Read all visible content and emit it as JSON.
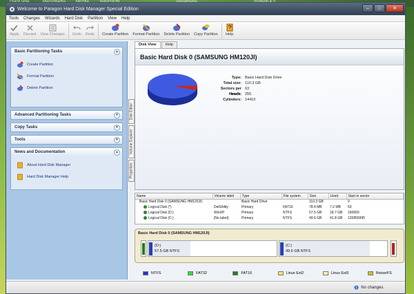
{
  "desktop": {
    "taskbar_items": [
      "QuickTime",
      "Macromedia",
      "Mozilla",
      "NAVISION",
      "vatvaktama",
      "msftedit 4.0"
    ]
  },
  "window": {
    "title": "Welcome to Paragon Hard Disk Manager Special Edition"
  },
  "menu": [
    "Tools",
    "Changes",
    "Wizards",
    "Hard Disk",
    "Partition",
    "View",
    "Help"
  ],
  "toolbar": {
    "apply": "Apply",
    "discard": "Discard",
    "view_changes": "View Changes",
    "undo": "Undo",
    "redo": "Redo",
    "create_partition": "Create Partition",
    "format_partition": "Format Partition",
    "delete_partition": "Delete Partition",
    "copy_partition": "Copy Partition",
    "help": "Help"
  },
  "sidebar": {
    "basic": {
      "title": "Basic Partitioning Tasks",
      "items": [
        "Create Partition",
        "Format Partition",
        "Delete Partition"
      ]
    },
    "advanced": {
      "title": "Advanced Partitioning Tasks"
    },
    "copy": {
      "title": "Copy Tasks"
    },
    "tools": {
      "title": "Tools"
    },
    "news": {
      "title": "News and Documentation",
      "items": [
        "About Hard Disk Manager",
        "Hard Disk Manager Help"
      ]
    }
  },
  "vtabs": [
    "Disk Editor",
    "Volume Explorer",
    "Properties"
  ],
  "tabs": [
    "Disk View",
    "Help"
  ],
  "disk": {
    "header": "Basic Hard Disk 0 (SAMSUNG HM120JI)",
    "props": [
      {
        "k": "Type:",
        "v": "Basic Hard Disk Drive"
      },
      {
        "k": "Total size:",
        "v": "110.3 GB"
      },
      {
        "k": "Sectors per track:",
        "v": "63"
      },
      {
        "k": "Heads:",
        "v": "255"
      },
      {
        "k": "Cylinders:",
        "v": "14410"
      }
    ],
    "pie": {
      "used_fraction": 0.98
    }
  },
  "table": {
    "headers": [
      "Name",
      "Volume label",
      "Type",
      "File system",
      "Size",
      "Used",
      "Start in sector"
    ],
    "rows": [
      {
        "name": "Basic Hard Disk 0 (SAMSUNG HM120JI)",
        "label": "",
        "type": "Basic Hard Drive",
        "fs": "",
        "size": "110.3 GB",
        "used": "",
        "start": "0",
        "child": false,
        "flag": ""
      },
      {
        "name": "Logical Disk (*)",
        "label": "DellUtility",
        "type": "Primary",
        "fs": "FAT16",
        "size": "78.4 MB",
        "used": "7.2 MB",
        "start": "63",
        "child": true,
        "flag": "#2f8f2f"
      },
      {
        "name": "Logical Disk (D:)",
        "label": "WinXP",
        "type": "Primary",
        "fs": "NTFS",
        "size": "57.5 GB",
        "used": "18.7 GB",
        "start": "160650",
        "child": true,
        "flag": "#2f7f2f"
      },
      {
        "name": "Logical Disk (C:)",
        "label": "[No label]",
        "type": "Primary",
        "fs": "NTFS",
        "size": "49.6 GB",
        "used": "41.8 GB",
        "start": "120856995",
        "child": true,
        "flag": "#2f7f2f"
      }
    ]
  },
  "map": {
    "title": "Basic Hard Disk 0 (SAMSUNG HM120JI)",
    "d": {
      "line1": "(D:)",
      "line2": "57.5 GB NTFS",
      "used_fraction": 0.33
    },
    "c": {
      "line1": "(C:)",
      "line2": "49.6 GB NTFS",
      "used_fraction": 0.84
    }
  },
  "legend": [
    {
      "label": "NTFS",
      "color": "#2233cc"
    },
    {
      "label": "FAT32",
      "color": "#33dd33"
    },
    {
      "label": "FAT16",
      "color": "#1f7f1f"
    },
    {
      "label": "Linux Ext2",
      "color": "#f2e866"
    },
    {
      "label": "Linux Ext3",
      "color": "#fff7a8"
    },
    {
      "label": "ReiserFS",
      "color": "#c9c224"
    }
  ],
  "status": {
    "text": "No changes."
  },
  "colors": {
    "ntfs": "#2233cc",
    "fat16": "#1f7f1f",
    "accent": "#b8301f"
  }
}
